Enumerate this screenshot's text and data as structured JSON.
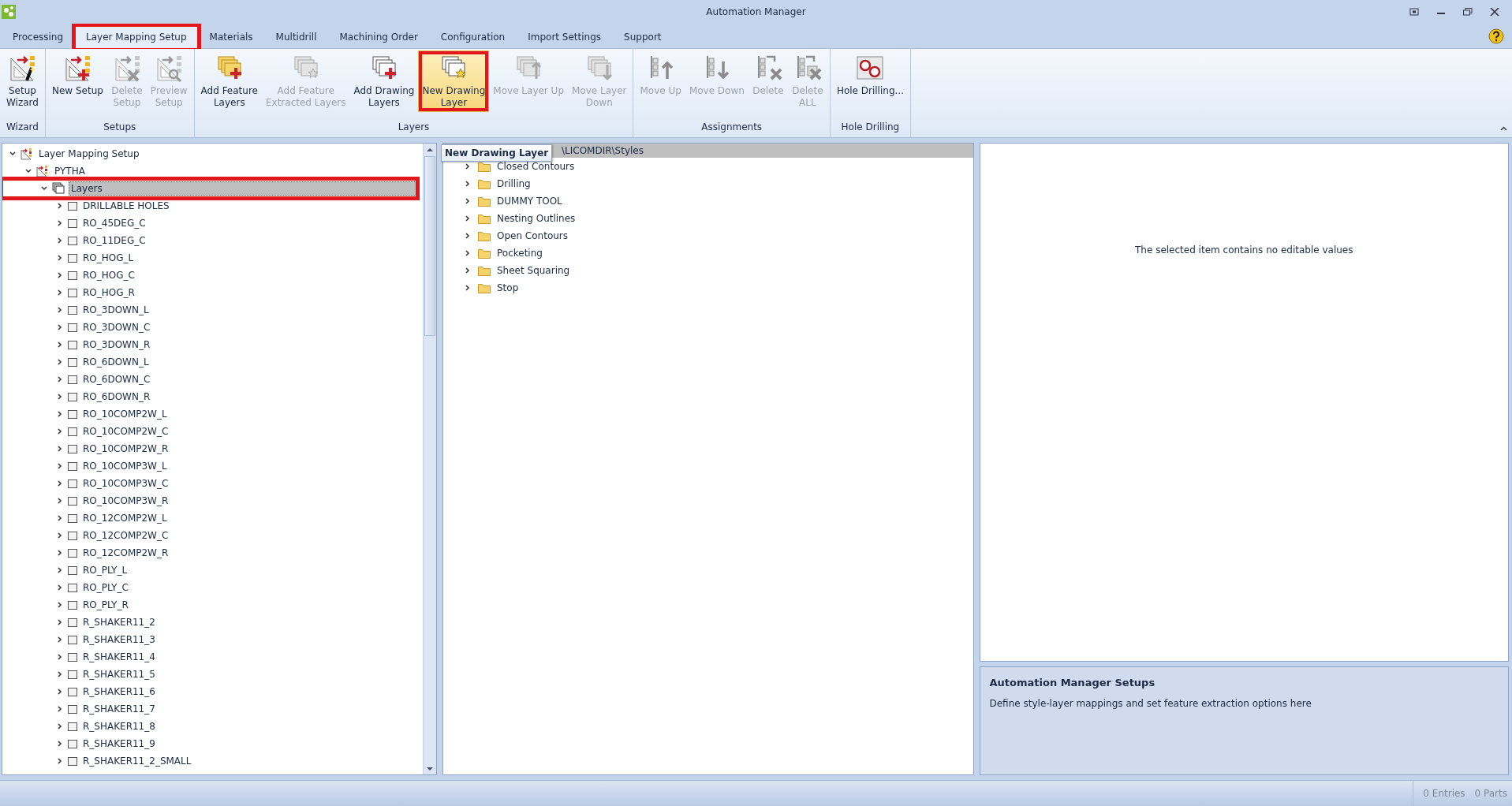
{
  "window": {
    "title": "Automation Manager"
  },
  "tabs": [
    {
      "label": "Processing",
      "selected": false,
      "highlighted": false
    },
    {
      "label": "Layer Mapping Setup",
      "selected": true,
      "highlighted": true
    },
    {
      "label": "Materials",
      "selected": false,
      "highlighted": false
    },
    {
      "label": "Multidrill",
      "selected": false,
      "highlighted": false
    },
    {
      "label": "Machining Order",
      "selected": false,
      "highlighted": false
    },
    {
      "label": "Configuration",
      "selected": false,
      "highlighted": false
    },
    {
      "label": "Import Settings",
      "selected": false,
      "highlighted": false
    },
    {
      "label": "Support",
      "selected": false,
      "highlighted": false
    }
  ],
  "ribbon": [
    {
      "label": "Wizard",
      "buttons": [
        {
          "label": "Setup\nWizard",
          "kind": "wizard",
          "disabled": false,
          "hovered": false,
          "highlighted": false
        }
      ]
    },
    {
      "label": "Setups",
      "buttons": [
        {
          "label": "New Setup",
          "kind": "setup-add",
          "disabled": false,
          "hovered": false,
          "highlighted": false
        },
        {
          "label": "Delete\nSetup",
          "kind": "setup-delete",
          "disabled": true,
          "hovered": false,
          "highlighted": false
        },
        {
          "label": "Preview\nSetup",
          "kind": "setup-preview",
          "disabled": true,
          "hovered": false,
          "highlighted": false
        }
      ]
    },
    {
      "label": "Layers",
      "buttons": [
        {
          "label": "Add Feature\nLayers",
          "kind": "layers-add-feature",
          "disabled": false,
          "hovered": false,
          "highlighted": false
        },
        {
          "label": "Add Feature\nExtracted Layers",
          "kind": "layers-star",
          "disabled": true,
          "hovered": false,
          "highlighted": false
        },
        {
          "label": "Add Drawing\nLayers",
          "kind": "layers-add",
          "disabled": false,
          "hovered": false,
          "highlighted": false
        },
        {
          "label": "New Drawing\nLayer",
          "kind": "layers-star",
          "disabled": false,
          "hovered": true,
          "highlighted": true
        },
        {
          "label": "Move Layer Up",
          "kind": "layers-up",
          "disabled": true,
          "hovered": false,
          "highlighted": false
        },
        {
          "label": "Move Layer\nDown",
          "kind": "layers-down",
          "disabled": true,
          "hovered": false,
          "highlighted": false
        }
      ]
    },
    {
      "label": "Assignments",
      "buttons": [
        {
          "label": "Move Up",
          "kind": "list-up",
          "disabled": true,
          "hovered": false,
          "highlighted": false
        },
        {
          "label": "Move Down",
          "kind": "list-down",
          "disabled": true,
          "hovered": false,
          "highlighted": false
        },
        {
          "label": "Delete",
          "kind": "list-delete",
          "disabled": true,
          "hovered": false,
          "highlighted": false
        },
        {
          "label": "Delete\nALL",
          "kind": "list-delete-all",
          "disabled": true,
          "hovered": false,
          "highlighted": false
        }
      ]
    },
    {
      "label": "Hole Drilling",
      "buttons": [
        {
          "label": "Hole Drilling...",
          "kind": "holes",
          "disabled": false,
          "hovered": false,
          "highlighted": false
        }
      ]
    }
  ],
  "tree": {
    "items": [
      {
        "label": "Layer Mapping Setup",
        "kind": "setup-root",
        "expanded": true,
        "selected": false,
        "highlighted": false,
        "children": [
          {
            "label": "PYTHA",
            "kind": "setup",
            "expanded": true,
            "selected": false,
            "highlighted": false,
            "children": [
              {
                "label": "Layers",
                "kind": "layers",
                "expanded": true,
                "selected": true,
                "highlighted": true,
                "children": [
                  {
                    "label": "DRILLABLE HOLES",
                    "kind": "layer",
                    "expanded": false,
                    "selected": false,
                    "highlighted": false
                  },
                  {
                    "label": "RO_45DEG_C",
                    "kind": "layer",
                    "expanded": false,
                    "selected": false,
                    "highlighted": false
                  },
                  {
                    "label": "RO_11DEG_C",
                    "kind": "layer",
                    "expanded": false,
                    "selected": false,
                    "highlighted": false
                  },
                  {
                    "label": "RO_HOG_L",
                    "kind": "layer",
                    "expanded": false,
                    "selected": false,
                    "highlighted": false
                  },
                  {
                    "label": "RO_HOG_C",
                    "kind": "layer",
                    "expanded": false,
                    "selected": false,
                    "highlighted": false
                  },
                  {
                    "label": "RO_HOG_R",
                    "kind": "layer",
                    "expanded": false,
                    "selected": false,
                    "highlighted": false
                  },
                  {
                    "label": "RO_3DOWN_L",
                    "kind": "layer",
                    "expanded": false,
                    "selected": false,
                    "highlighted": false
                  },
                  {
                    "label": "RO_3DOWN_C",
                    "kind": "layer",
                    "expanded": false,
                    "selected": false,
                    "highlighted": false
                  },
                  {
                    "label": "RO_3DOWN_R",
                    "kind": "layer",
                    "expanded": false,
                    "selected": false,
                    "highlighted": false
                  },
                  {
                    "label": "RO_6DOWN_L",
                    "kind": "layer",
                    "expanded": false,
                    "selected": false,
                    "highlighted": false
                  },
                  {
                    "label": "RO_6DOWN_C",
                    "kind": "layer",
                    "expanded": false,
                    "selected": false,
                    "highlighted": false
                  },
                  {
                    "label": "RO_6DOWN_R",
                    "kind": "layer",
                    "expanded": false,
                    "selected": false,
                    "highlighted": false
                  },
                  {
                    "label": "RO_10COMP2W_L",
                    "kind": "layer",
                    "expanded": false,
                    "selected": false,
                    "highlighted": false
                  },
                  {
                    "label": "RO_10COMP2W_C",
                    "kind": "layer",
                    "expanded": false,
                    "selected": false,
                    "highlighted": false
                  },
                  {
                    "label": "RO_10COMP2W_R",
                    "kind": "layer",
                    "expanded": false,
                    "selected": false,
                    "highlighted": false
                  },
                  {
                    "label": "RO_10COMP3W_L",
                    "kind": "layer",
                    "expanded": false,
                    "selected": false,
                    "highlighted": false
                  },
                  {
                    "label": "RO_10COMP3W_C",
                    "kind": "layer",
                    "expanded": false,
                    "selected": false,
                    "highlighted": false
                  },
                  {
                    "label": "RO_10COMP3W_R",
                    "kind": "layer",
                    "expanded": false,
                    "selected": false,
                    "highlighted": false
                  },
                  {
                    "label": "RO_12COMP2W_L",
                    "kind": "layer",
                    "expanded": false,
                    "selected": false,
                    "highlighted": false
                  },
                  {
                    "label": "RO_12COMP2W_C",
                    "kind": "layer",
                    "expanded": false,
                    "selected": false,
                    "highlighted": false
                  },
                  {
                    "label": "RO_12COMP2W_R",
                    "kind": "layer",
                    "expanded": false,
                    "selected": false,
                    "highlighted": false
                  },
                  {
                    "label": "RO_PLY_L",
                    "kind": "layer",
                    "expanded": false,
                    "selected": false,
                    "highlighted": false
                  },
                  {
                    "label": "RO_PLY_C",
                    "kind": "layer",
                    "expanded": false,
                    "selected": false,
                    "highlighted": false
                  },
                  {
                    "label": "RO_PLY_R",
                    "kind": "layer",
                    "expanded": false,
                    "selected": false,
                    "highlighted": false
                  },
                  {
                    "label": "R_SHAKER11_2",
                    "kind": "layer",
                    "expanded": false,
                    "selected": false,
                    "highlighted": false
                  },
                  {
                    "label": "R_SHAKER11_3",
                    "kind": "layer",
                    "expanded": false,
                    "selected": false,
                    "highlighted": false
                  },
                  {
                    "label": "R_SHAKER11_4",
                    "kind": "layer",
                    "expanded": false,
                    "selected": false,
                    "highlighted": false
                  },
                  {
                    "label": "R_SHAKER11_5",
                    "kind": "layer",
                    "expanded": false,
                    "selected": false,
                    "highlighted": false
                  },
                  {
                    "label": "R_SHAKER11_6",
                    "kind": "layer",
                    "expanded": false,
                    "selected": false,
                    "highlighted": false
                  },
                  {
                    "label": "R_SHAKER11_7",
                    "kind": "layer",
                    "expanded": false,
                    "selected": false,
                    "highlighted": false
                  },
                  {
                    "label": "R_SHAKER11_8",
                    "kind": "layer",
                    "expanded": false,
                    "selected": false,
                    "highlighted": false
                  },
                  {
                    "label": "R_SHAKER11_9",
                    "kind": "layer",
                    "expanded": false,
                    "selected": false,
                    "highlighted": false
                  },
                  {
                    "label": "R_SHAKER11_2_SMALL",
                    "kind": "layer",
                    "expanded": false,
                    "selected": false,
                    "highlighted": false
                  }
                ]
              }
            ]
          }
        ]
      }
    ]
  },
  "styles": {
    "path": "\\LICOMDIR\\Styles",
    "tooltip": "New Drawing Layer",
    "items": [
      {
        "label": "Closed Contours",
        "expanded": false
      },
      {
        "label": "Drilling",
        "expanded": false
      },
      {
        "label": "DUMMY TOOL",
        "expanded": false
      },
      {
        "label": "Nesting Outlines",
        "expanded": false
      },
      {
        "label": "Open Contours",
        "expanded": false
      },
      {
        "label": "Pocketing",
        "expanded": false
      },
      {
        "label": "Sheet Squaring",
        "expanded": false
      },
      {
        "label": "Stop",
        "expanded": false
      }
    ]
  },
  "properties": {
    "message": "The selected item contains no editable values"
  },
  "info": {
    "title": "Automation Manager Setups",
    "text": "Define style-layer mappings and set feature extraction options here"
  },
  "status_bar": {
    "entries": "0 Entries",
    "parts": "0 Parts"
  }
}
